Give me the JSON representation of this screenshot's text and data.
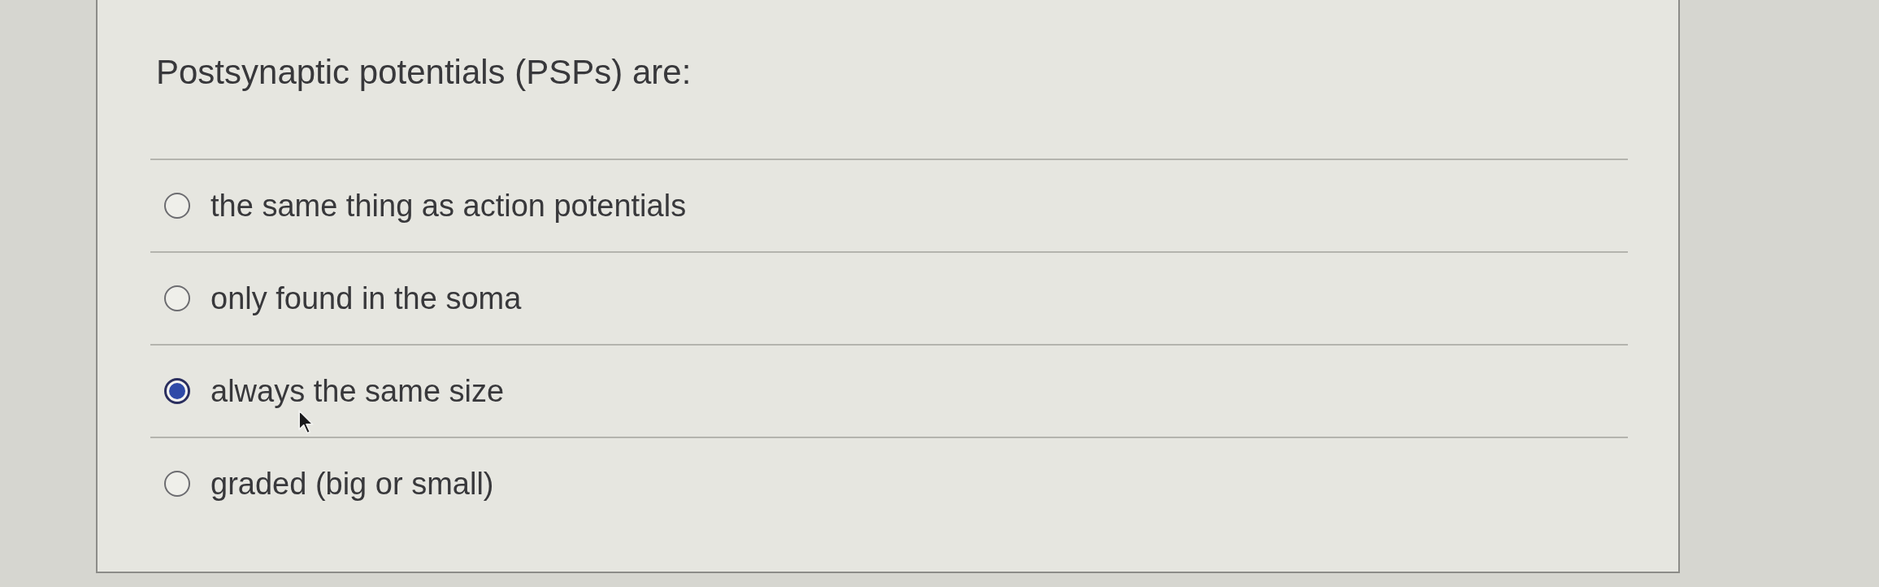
{
  "question": {
    "text": "Postsynaptic potentials (PSPs) are:"
  },
  "options": [
    {
      "label": "the same thing as action potentials",
      "selected": false
    },
    {
      "label": "only found in the soma",
      "selected": false
    },
    {
      "label": "always the same size",
      "selected": true
    },
    {
      "label": "graded (big or small)",
      "selected": false
    }
  ]
}
